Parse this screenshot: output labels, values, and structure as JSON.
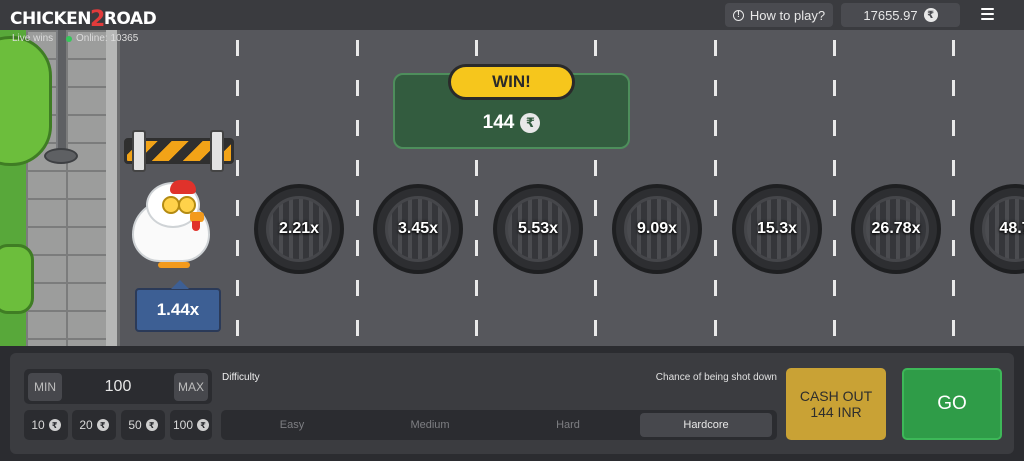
{
  "header": {
    "logo_part1": "CHICKEN",
    "logo_part2": "2",
    "logo_part3": "ROAD",
    "help_label": "How to play?",
    "balance": "17655.97",
    "currency_symbol": "₹"
  },
  "status": {
    "live_wins_label": "Live wins",
    "online_label": "Online: 10365"
  },
  "game": {
    "current_multiplier": "1.44x",
    "lanes": [
      "2.21x",
      "3.45x",
      "5.53x",
      "9.09x",
      "15.3x",
      "26.78x",
      "48.7"
    ],
    "win_label": "WIN!",
    "win_amount": "144",
    "win_currency": "₹"
  },
  "controls": {
    "min_label": "MIN",
    "max_label": "MAX",
    "bet_amount": "100",
    "quick_bets": [
      "10",
      "20",
      "50",
      "100"
    ],
    "difficulty_label": "Difficulty",
    "chance_label": "Chance of being shot down",
    "difficulty_options": [
      "Easy",
      "Medium",
      "Hard",
      "Hardcore"
    ],
    "selected_difficulty": "Hardcore",
    "cashout_line1": "CASH OUT",
    "cashout_line2": "144 INR",
    "go_label": "GO"
  },
  "colors": {
    "cashout": "#c9a235",
    "go": "#2f9c48",
    "win_badge": "#f6c61c",
    "win_panel": "#335c3f",
    "multiplier_tag": "#3d5f94"
  }
}
